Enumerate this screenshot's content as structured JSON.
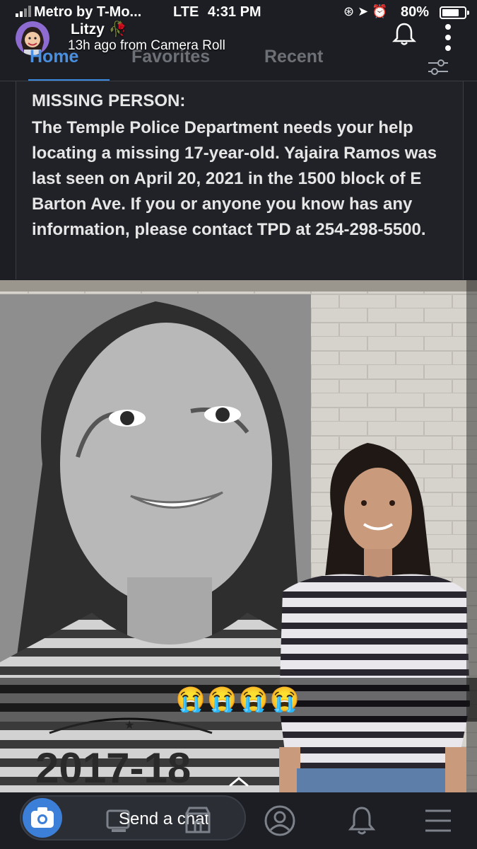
{
  "status_bar": {
    "carrier": "Metro by T-Mo...",
    "network": "LTE",
    "time": "4:31 PM",
    "battery_percent": "80%",
    "battery_level": 0.8
  },
  "story": {
    "user_name": "Litzy",
    "user_emoji": "🥀",
    "subtitle": "13h ago from Camera Roll"
  },
  "tabs": [
    {
      "label": "Home",
      "active": true
    },
    {
      "label": "Favorites",
      "active": false
    },
    {
      "label": "Recent",
      "active": false
    }
  ],
  "post": {
    "title": "MISSING PERSON:",
    "body": "The Temple Police Department needs your help locating a missing 17-year-old. Yajaira Ramos was last seen on April 20, 2021 in the 1500 block of E Barton Ave. If you or anyone you know has any information, please contact TPD at 254-298-5500."
  },
  "photo": {
    "caption": "😭😭😭😭",
    "banner_text": "2017-18"
  },
  "bottom_bar": {
    "chat_placeholder": "Send a chat"
  },
  "colors": {
    "accent": "#3d8be0",
    "background": "#1c1e23"
  }
}
